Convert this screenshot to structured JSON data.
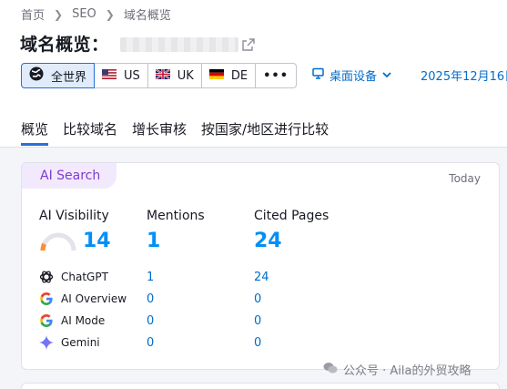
{
  "breadcrumb": {
    "items": [
      "首页",
      "SEO",
      "域名概览"
    ]
  },
  "title": {
    "text": "域名概览："
  },
  "databases": [
    {
      "label": "全世界",
      "icon": "globe-icon",
      "active": true
    },
    {
      "label": "US",
      "icon": "us-flag-icon",
      "active": false
    },
    {
      "label": "UK",
      "icon": "uk-flag-icon",
      "active": false
    },
    {
      "label": "DE",
      "icon": "de-flag-icon",
      "active": false
    },
    {
      "label": "•••",
      "icon": "more-icon",
      "active": false
    }
  ],
  "device": {
    "label": "桌面设备",
    "icon": "desktop-icon"
  },
  "date": {
    "label": "2025年12月16日"
  },
  "tabs": [
    "概览",
    "比较域名",
    "增长审核",
    "按国家/地区进行比较"
  ],
  "card": {
    "badge": "AI Search",
    "date": "Today",
    "metrics": [
      {
        "label": "AI Visibility",
        "value": "14"
      },
      {
        "label": "Mentions",
        "value": "1"
      },
      {
        "label": "Cited Pages",
        "value": "24"
      }
    ],
    "visibility_gauge_fraction": 0.14,
    "engines": [
      {
        "name": "ChatGPT",
        "icon": "chatgpt-icon",
        "mentions": "1",
        "cited": "24"
      },
      {
        "name": "AI Overview",
        "icon": "google-icon",
        "mentions": "0",
        "cited": "0"
      },
      {
        "name": "AI Mode",
        "icon": "google-icon",
        "mentions": "0",
        "cited": "0"
      },
      {
        "name": "Gemini",
        "icon": "gemini-icon",
        "mentions": "0",
        "cited": "0"
      }
    ]
  },
  "watermark": {
    "text": "公众号 · Aila的外贸攻略"
  },
  "colors": {
    "accent": "#006dca",
    "metric": "#008ff8",
    "badge_bg": "#f2e9fd",
    "badge_text": "#7e3bd0",
    "gauge": "#ff8c2f"
  }
}
